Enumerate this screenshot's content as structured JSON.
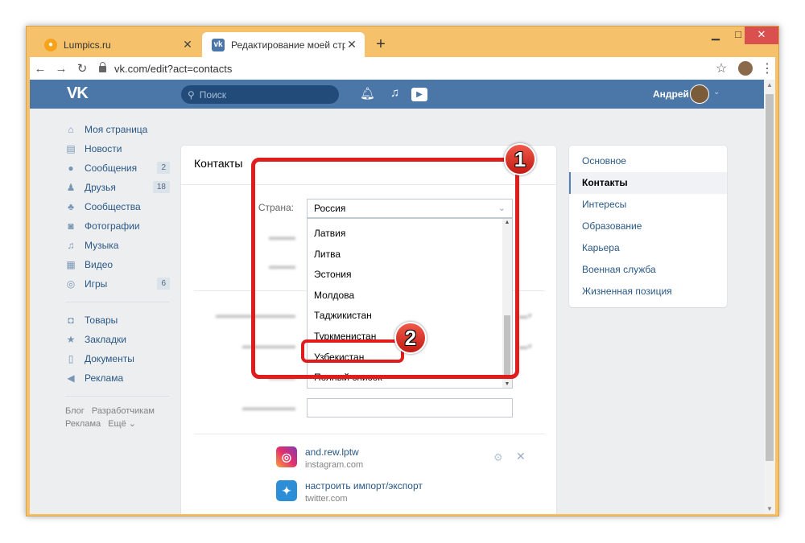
{
  "browser": {
    "tabs": [
      {
        "title": "Lumpics.ru",
        "favicon": "lumpics-favicon-icon"
      },
      {
        "title": "Редактирование моей страницы",
        "favicon": "vk-favicon-icon"
      }
    ],
    "url": "vk.com/edit?act=contacts"
  },
  "vk_header": {
    "logo": "VK",
    "search_placeholder": "Поиск",
    "user_name": "Андрей"
  },
  "left_nav": {
    "items": [
      {
        "label": "Моя страница",
        "icon": "home-icon",
        "glyph": "⌂"
      },
      {
        "label": "Новости",
        "icon": "news-icon",
        "glyph": "▤"
      },
      {
        "label": "Сообщения",
        "icon": "messages-icon",
        "glyph": "●",
        "badge": "2"
      },
      {
        "label": "Друзья",
        "icon": "friends-icon",
        "glyph": "♟",
        "badge": "18"
      },
      {
        "label": "Сообщества",
        "icon": "communities-icon",
        "glyph": "♣"
      },
      {
        "label": "Фотографии",
        "icon": "photos-icon",
        "glyph": "◙"
      },
      {
        "label": "Музыка",
        "icon": "music-icon",
        "glyph": "♫"
      },
      {
        "label": "Видео",
        "icon": "video-icon",
        "glyph": "▦"
      },
      {
        "label": "Игры",
        "icon": "games-icon",
        "glyph": "◎",
        "badge": "6"
      }
    ],
    "items2": [
      {
        "label": "Товары",
        "icon": "goods-icon",
        "glyph": "◘"
      },
      {
        "label": "Закладки",
        "icon": "bookmarks-icon",
        "glyph": "★"
      },
      {
        "label": "Документы",
        "icon": "documents-icon",
        "glyph": "▯"
      },
      {
        "label": "Реклама",
        "icon": "ads-icon",
        "glyph": "◀"
      }
    ],
    "footer": [
      "Блог",
      "Разработчикам",
      "Реклама",
      "Ещё ⌄"
    ]
  },
  "main": {
    "title": "Контакты",
    "country_label": "Страна:",
    "country_value": "Россия",
    "country_options": [
      "Латвия",
      "Литва",
      "Эстония",
      "Молдова",
      "Таджикистан",
      "Туркменистан",
      "Узбекистан",
      "Полный список"
    ],
    "social": [
      {
        "name": "and.rew.lptw",
        "sub": "instagram.com",
        "icon": "instagram-icon",
        "glyph": "◎"
      },
      {
        "name": "настроить импорт/экспорт",
        "sub": "twitter.com",
        "icon": "twitter-icon",
        "glyph": "✦"
      }
    ]
  },
  "right_nav": {
    "items": [
      "Основное",
      "Контакты",
      "Интересы",
      "Образование",
      "Карьера",
      "Военная служба",
      "Жизненная позиция"
    ],
    "active": "Контакты"
  },
  "annotations": {
    "step1": "1",
    "step2": "2"
  },
  "colors": {
    "vk_blue": "#4a76a8",
    "annotation_red": "#e01c1c",
    "link": "#2a5885"
  }
}
